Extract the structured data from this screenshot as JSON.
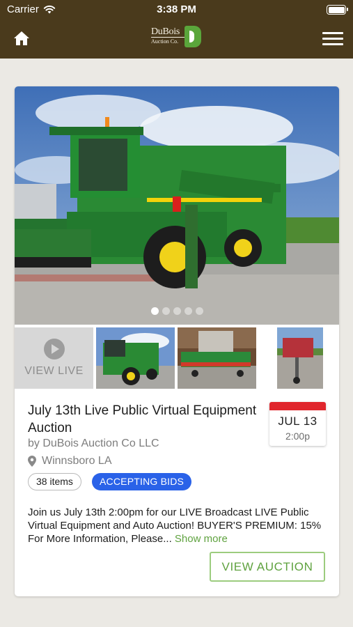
{
  "status_bar": {
    "carrier": "Carrier",
    "time": "3:38 PM"
  },
  "nav": {
    "logo_text": "DuBois",
    "logo_subtext": "Auction Co."
  },
  "auction": {
    "title": "July 13th Live Public Virtual Equipment Auction",
    "seller": "by DuBois Auction Co LLC",
    "location": "Winnsboro LA",
    "date": "JUL 13",
    "time": "2:00p",
    "items_count": "38 items",
    "status": "ACCEPTING BIDS",
    "description": "Join us July 13th 2:00pm for our LIVE Broadcast LIVE Public Virtual Equipment and Auto Auction! BUYER'S PREMIUM: 15% For More Information, Please...",
    "show_more": "Show more",
    "view_live": "VIEW LIVE",
    "view_button": "VIEW AUCTION",
    "carousel_index": 1,
    "carousel_total": 5
  },
  "colors": {
    "header": "#4a3a1c",
    "accent_green": "#5fa23f",
    "status_blue": "#2a62e8",
    "calendar_red": "#e0262d",
    "background": "#ebe9e4"
  },
  "icons": [
    "wifi-icon",
    "battery-icon",
    "home-icon",
    "hamburger-menu-icon",
    "play-icon",
    "location-pin-icon"
  ]
}
